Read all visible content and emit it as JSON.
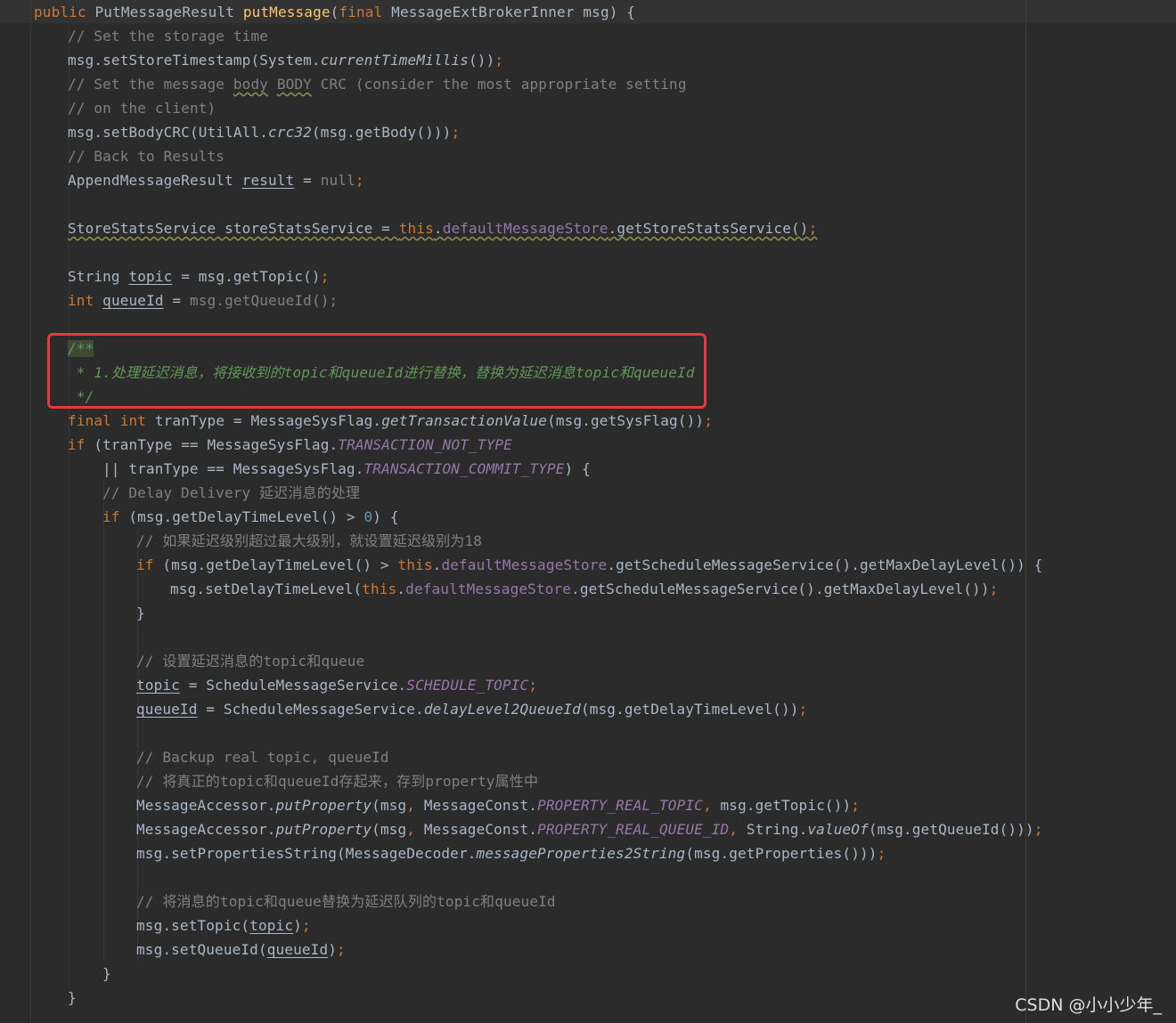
{
  "code": {
    "l1_public": "public",
    "l1_return": "PutMessageResult",
    "l1_method": "putMessage",
    "l1_open": "(",
    "l1_final": "final",
    "l1_params": "MessageExtBrokerInner msg) {",
    "l2": "// Set the storage time",
    "l3_a": "msg.setStoreTimestamp(System.",
    "l3_b": "currentTimeMillis",
    "l3_c": "())",
    "l3_semi": ";",
    "l4_a": "// Set the message ",
    "l4_b": "body",
    "l4_c": " ",
    "l4_d": "BODY",
    "l4_e": " CRC (consider the most appropriate setting",
    "l5": "// on the client)",
    "l6_a": "msg.setBodyCRC(UtilAll.",
    "l6_b": "crc32",
    "l6_c": "(msg.getBody()))",
    "l6_semi": ";",
    "l7": "// Back to Results",
    "l8_a": "AppendMessageResult ",
    "l8_b": "result",
    "l8_c": " = ",
    "l8_null": "null",
    "l8_semi": ";",
    "l10_a": "StoreStatsService storeStatsService = ",
    "l10_this": "this",
    "l10_dot": ".",
    "l10_field": "defaultMessageStore",
    "l10_c": ".getStoreStatsService()",
    "l10_semi": ";",
    "l12_a": "String ",
    "l12_b": "topic",
    "l12_c": " = msg.getTopic()",
    "l12_semi": ";",
    "l13_int": "int",
    "l13_sp": " ",
    "l13_b": "queueId",
    "l13_c": " = ",
    "l13_d": "msg.getQueueId()",
    "l13_semi": ";",
    "l15": "/**",
    "l16_a": " * 1.处理延迟消息，将接收到的",
    "l16_b": "topic",
    "l16_c": "和",
    "l16_d": "queueId",
    "l16_e": "进行替换，替换为延迟消息",
    "l16_f": "topic",
    "l16_g": "和",
    "l16_h": "queueId",
    "l17": " */",
    "l18_final": "final",
    "l18_sp1": " ",
    "l18_int": "int",
    "l18_a": " tranType = MessageSysFlag.",
    "l18_b": "getTransactionValue",
    "l18_c": "(msg.getSysFlag())",
    "l18_semi": ";",
    "l19_if": "if",
    "l19_a": " (tranType == MessageSysFlag.",
    "l19_b": "TRANSACTION_NOT_TYPE",
    "l20_a": "|| tranType == MessageSysFlag.",
    "l20_b": "TRANSACTION_COMMIT_TYPE",
    "l20_c": ") {",
    "l21": "// Delay Delivery 延迟消息的处理",
    "l22_if": "if",
    "l22_a": " (msg.getDelayTimeLevel() > ",
    "l22_num": "0",
    "l22_c": ") {",
    "l23": "// 如果延迟级别超过最大级别，就设置延迟级别为18",
    "l24_if": "if",
    "l24_a": " (msg.getDelayTimeLevel() > ",
    "l24_this": "this",
    "l24_dot": ".",
    "l24_field": "defaultMessageStore",
    "l24_c": ".getScheduleMessageService().getMaxDelayLevel()) {",
    "l25_a": "msg.setDelayTimeLevel(",
    "l25_this": "this",
    "l25_dot": ".",
    "l25_field": "defaultMessageStore",
    "l25_c": ".getScheduleMessageService().getMaxDelayLevel())",
    "l25_semi": ";",
    "l26": "}",
    "l28": "// 设置延迟消息的topic和queue",
    "l29_a": "topic",
    "l29_b": " = ScheduleMessageService.",
    "l29_c": "SCHEDULE_TOPIC",
    "l29_semi": ";",
    "l30_a": "queueId",
    "l30_b": " = ScheduleMessageService.",
    "l30_c": "delayLevel2QueueId",
    "l30_d": "(msg.getDelayTimeLevel())",
    "l30_semi": ";",
    "l32": "// Backup real topic, queueId",
    "l33": "// 将真正的topic和queueId存起来，存到property属性中",
    "l34_a": "MessageAccessor.",
    "l34_b": "putProperty",
    "l34_c": "(msg",
    "l34_comma1": ",",
    "l34_d": " MessageConst.",
    "l34_e": "PROPERTY_REAL_TOPIC",
    "l34_comma2": ",",
    "l34_f": " msg.getTopic())",
    "l34_semi": ";",
    "l35_a": "MessageAccessor.",
    "l35_b": "putProperty",
    "l35_c": "(msg",
    "l35_comma1": ",",
    "l35_d": " MessageConst.",
    "l35_e": "PROPERTY_REAL_QUEUE_ID",
    "l35_comma2": ",",
    "l35_f": " String.",
    "l35_g": "valueOf",
    "l35_h": "(msg.getQueueId()))",
    "l35_semi": ";",
    "l36_a": "msg.setPropertiesString(MessageDecoder.",
    "l36_b": "messageProperties2String",
    "l36_c": "(msg.getProperties()))",
    "l36_semi": ";",
    "l38": "// 将消息的topic和queue替换为延迟队列的topic和queueId",
    "l39_a": "msg.setTopic(",
    "l39_b": "topic",
    "l39_c": ")",
    "l39_semi": ";",
    "l40_a": "msg.setQueueId(",
    "l40_b": "queueId",
    "l40_c": ")",
    "l40_semi": ";",
    "l41": "}",
    "l42": "}"
  },
  "watermark": "CSDN @小小少年_",
  "colors": {
    "background": "#2b2b2b",
    "keyword": "#cc7832",
    "method_decl": "#ffc66d",
    "comment": "#808080",
    "doc_comment": "#629755",
    "field": "#9876aa",
    "number": "#6897bb",
    "text": "#a9b7c6",
    "highlight_box": "#e5393a"
  }
}
